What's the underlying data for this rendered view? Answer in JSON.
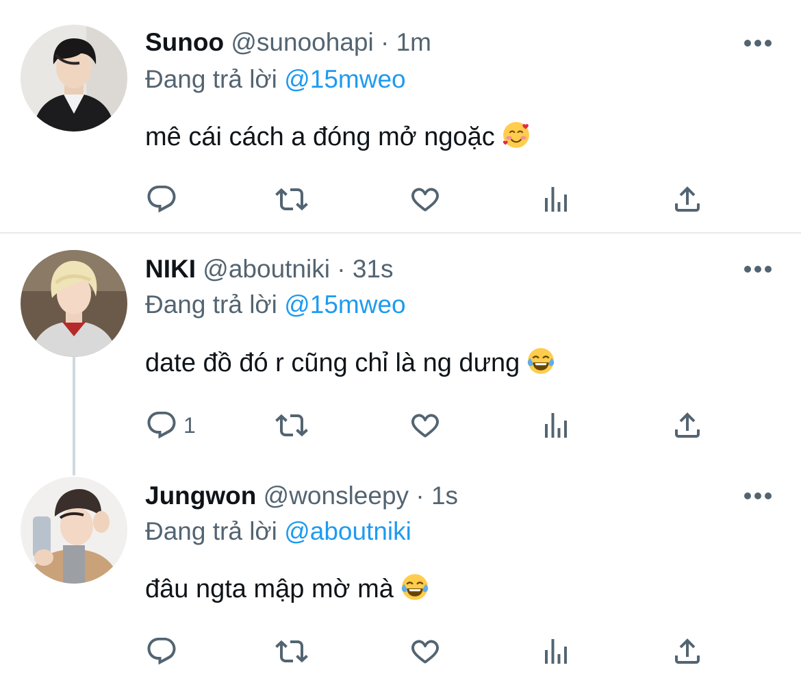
{
  "tweets": [
    {
      "name": "Sunoo",
      "handle": "@sunoohapi",
      "separator": "·",
      "time": "1m",
      "replying_prefix": "Đang trả lời",
      "replying_to": "@15mweo",
      "text": "mê cái cách a đóng mở ngoặc",
      "emoji": "smiling-face-with-hearts",
      "reply_count": ""
    },
    {
      "name": "NIKI",
      "handle": "@aboutniki",
      "separator": "·",
      "time": "31s",
      "replying_prefix": "Đang trả lời",
      "replying_to": "@15mweo",
      "text": "date đồ đó r cũng chỉ là ng dưng",
      "emoji": "face-with-tears-of-joy",
      "reply_count": "1"
    },
    {
      "name": "Jungwon",
      "handle": "@wonsleepy",
      "separator": "·",
      "time": "1s",
      "replying_prefix": "Đang trả lời",
      "replying_to": "@aboutniki",
      "text": "đâu ngta mập mờ mà",
      "emoji": "face-with-tears-of-joy",
      "reply_count": ""
    }
  ],
  "colors": {
    "text": "#0f1419",
    "secondary": "#536471",
    "link": "#1d9bf0",
    "divider": "#e6e9ec",
    "thread_line": "#cfd9de"
  },
  "icons": [
    "reply-icon",
    "retweet-icon",
    "like-icon",
    "analytics-icon",
    "share-icon",
    "more-icon"
  ]
}
